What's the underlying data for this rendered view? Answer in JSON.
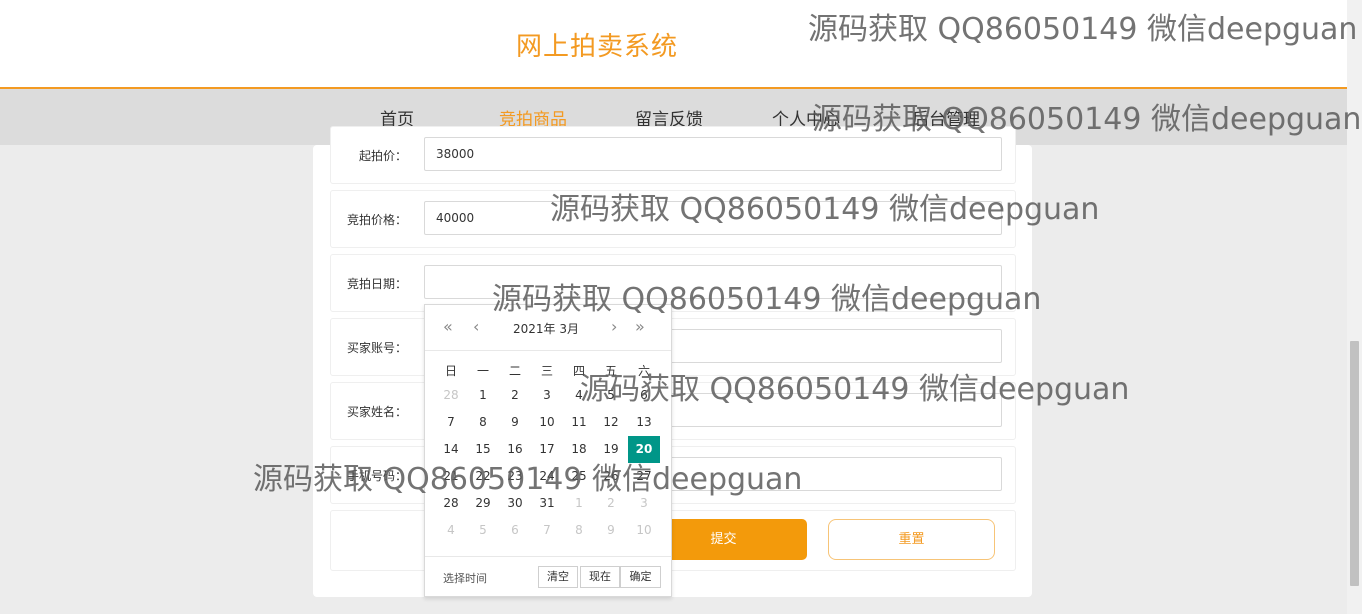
{
  "site": {
    "title": "网上拍卖系统"
  },
  "nav": {
    "items": [
      "首页",
      "竞拍商品",
      "留言反馈",
      "个人中心",
      "后台管理"
    ],
    "active_index": 1
  },
  "form": {
    "rows": [
      {
        "label": "起拍价：",
        "value": "38000"
      },
      {
        "label": "竞拍价格：",
        "value": "40000"
      },
      {
        "label": "竞拍日期：",
        "value": ""
      },
      {
        "label": "买家账号：",
        "value": ""
      },
      {
        "label": "买家姓名：",
        "value": ""
      },
      {
        "label": "手机号码：",
        "value": ""
      }
    ],
    "submit": "提交",
    "reset": "重置"
  },
  "datepicker": {
    "year_month": "2021年  3月",
    "weekdays": [
      "日",
      "一",
      "二",
      "三",
      "四",
      "五",
      "六"
    ],
    "days": [
      [
        "28",
        "1",
        "2",
        "3",
        "4",
        "5",
        "6"
      ],
      [
        "7",
        "8",
        "9",
        "10",
        "11",
        "12",
        "13"
      ],
      [
        "14",
        "15",
        "16",
        "17",
        "18",
        "19",
        "20"
      ],
      [
        "21",
        "22",
        "23",
        "24",
        "25",
        "26",
        "27"
      ],
      [
        "28",
        "29",
        "30",
        "31",
        "1",
        "2",
        "3"
      ],
      [
        "4",
        "5",
        "6",
        "7",
        "8",
        "9",
        "10"
      ]
    ],
    "selected": "20",
    "footer_label": "选择时间",
    "clear": "清空",
    "now": "现在",
    "confirm": "确定",
    "accent_color": "#009688"
  },
  "watermarks": [
    "源码获取 QQ86050149 微信deepguan",
    "源码获取 QQ86050149 微信deepguan",
    "源码获取 QQ86050149 微信deepguan",
    "源码获取 QQ86050149 微信deepguan",
    "源码获取 QQ86050149 微信deepguan",
    "源码获取 QQ86050149 微信deepguan"
  ]
}
